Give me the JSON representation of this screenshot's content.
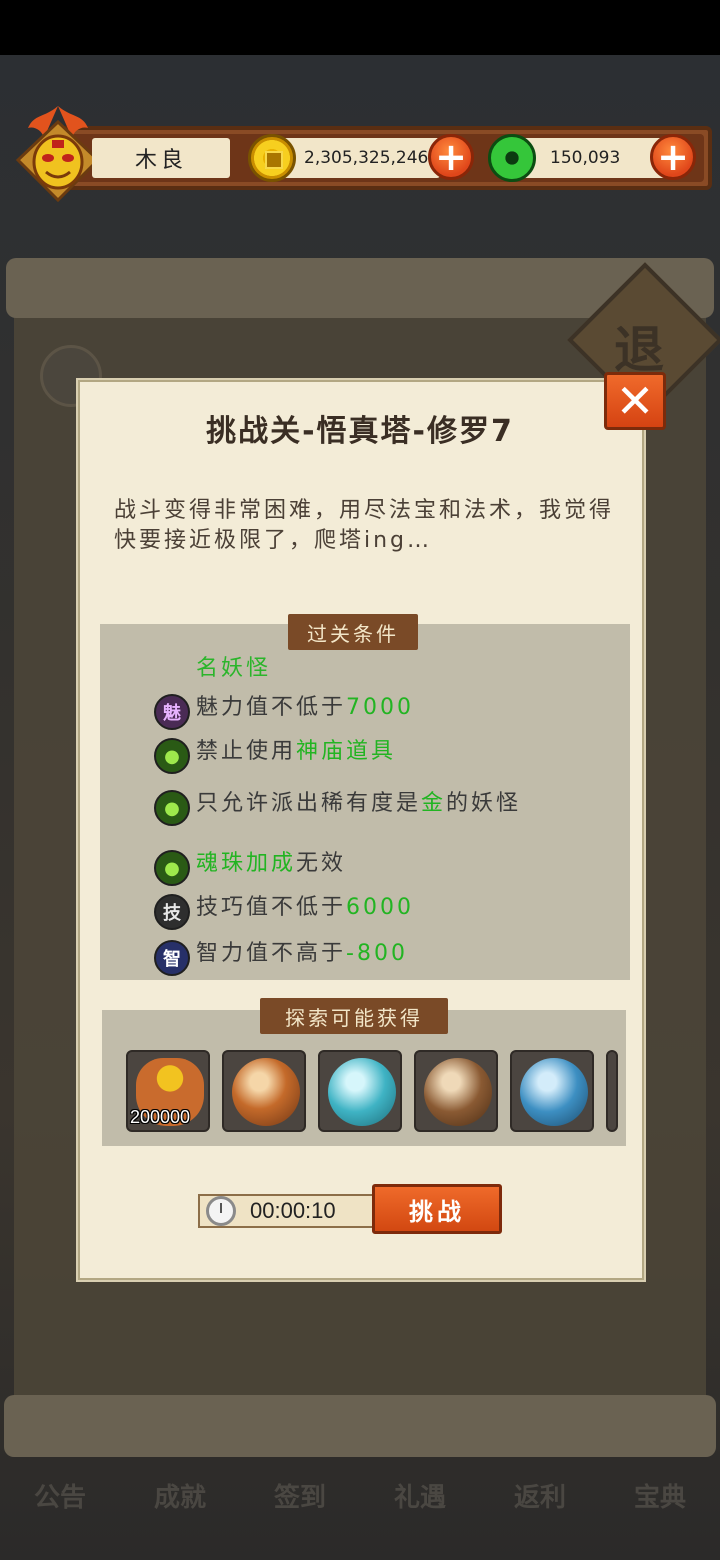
{
  "header": {
    "player_name": "木良",
    "coins": "2,305,325,246",
    "jade": "150,093",
    "add_label": "+"
  },
  "background": {
    "retreat_label": "退",
    "bottom_nav": [
      "公告",
      "成就",
      "签到",
      "礼遇",
      "返利",
      "宝典"
    ]
  },
  "dialog": {
    "title": "挑战关-悟真塔-修罗7",
    "close_label": "✕",
    "description": "战斗变得非常困难，用尽法宝和法术，我觉得快要接近极限了，爬塔ing…",
    "conditions_label": "过关条件",
    "conditions_clipped": "名妖怪",
    "conditions": [
      {
        "icon": "charm-icon",
        "glyph": "魅",
        "text": "魅力值不低于",
        "highlight": "7000",
        "suffix": ""
      },
      {
        "icon": "rule-icon",
        "glyph": "●",
        "text": "禁止使用",
        "highlight": "神庙道具",
        "suffix": ""
      },
      {
        "icon": "rule-icon",
        "glyph": "●",
        "text": "只允许派出稀有度是",
        "highlight": "金",
        "suffix": "的妖怪"
      },
      {
        "icon": "rule-icon",
        "glyph": "●",
        "text": "",
        "highlight": "魂珠加成",
        "suffix": "无效"
      },
      {
        "icon": "skill-icon",
        "glyph": "技",
        "text": "技巧值不低于",
        "highlight": "6000",
        "suffix": ""
      },
      {
        "icon": "intellect-icon",
        "glyph": "智",
        "text": "智力值不高于",
        "highlight": "-800",
        "suffix": ""
      }
    ],
    "rewards_label": "探索可能获得",
    "rewards": [
      {
        "icon": "gold-bag-icon",
        "count": "200000",
        "color": "#c96b2d"
      },
      {
        "icon": "fire-triangle-orb-icon",
        "count": "",
        "color": "#c46a2a"
      },
      {
        "icon": "puzzle-orb-icon",
        "count": "",
        "color": "#3fb3c4"
      },
      {
        "icon": "toast-orb-icon",
        "count": "",
        "color": "#8a5a33"
      },
      {
        "icon": "eye-pyramid-orb-icon",
        "count": "",
        "color": "#3d8fc2"
      }
    ],
    "timer": "00:00:10",
    "challenge_label": "挑战"
  }
}
